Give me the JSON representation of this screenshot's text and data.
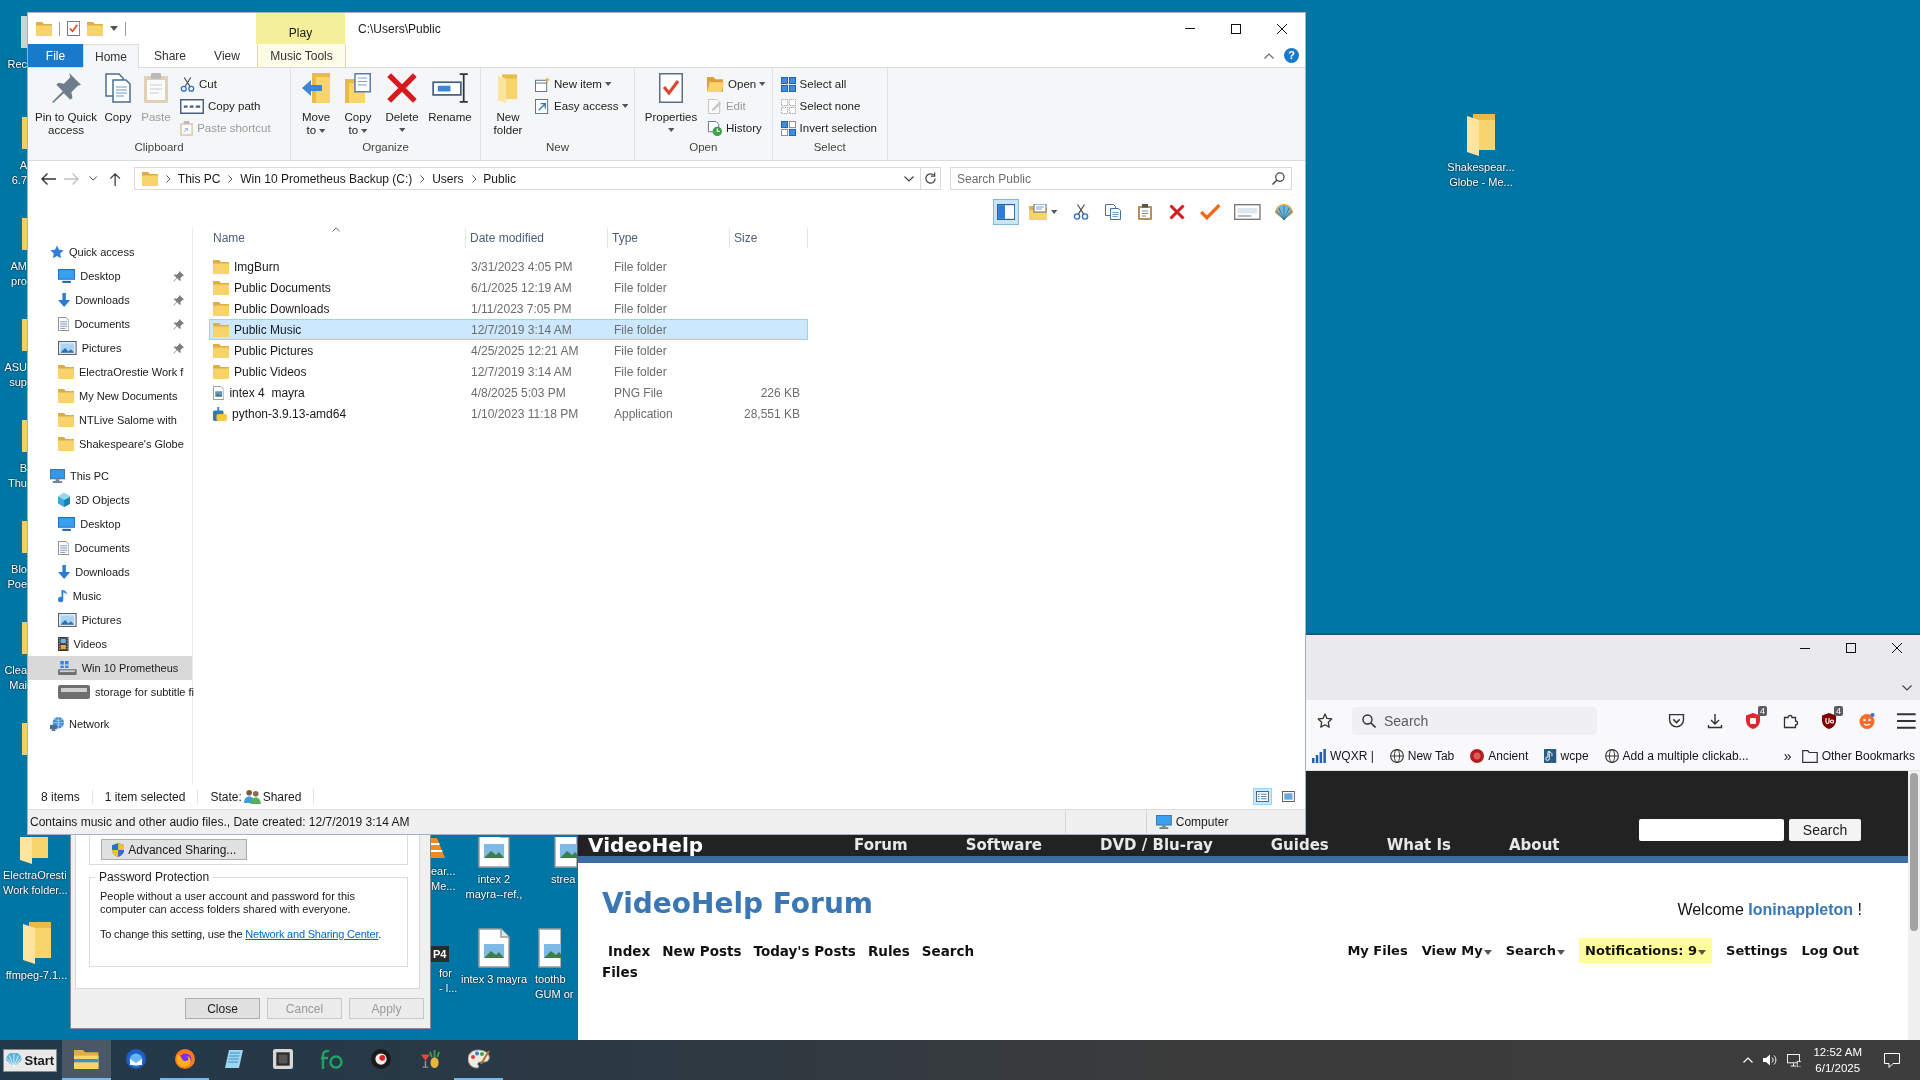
{
  "desktop": {
    "edge_icons": [
      {
        "kind": "recycle",
        "lines": [
          "Rec"
        ]
      },
      {
        "kind": "folder",
        "lines": [
          "A",
          "6.7"
        ]
      },
      {
        "kind": "folder",
        "lines": [
          "AM",
          "pro"
        ]
      },
      {
        "kind": "folder",
        "lines": [
          "ASU",
          "sup"
        ]
      },
      {
        "kind": "folder",
        "lines": [
          "B",
          "Thu"
        ]
      },
      {
        "kind": "folder",
        "lines": [
          "Blo",
          "Poe"
        ]
      },
      {
        "kind": "folder",
        "lines": [
          "Clea",
          "Mai"
        ]
      },
      {
        "kind": "folder"
      }
    ],
    "icons": [
      {
        "kind": "folder",
        "lines": [
          "ElectraOresti",
          "Work folder..."
        ]
      },
      {
        "kind": "folder",
        "lines": [
          "ffmpeg-7.1..."
        ]
      },
      {
        "kind": "cone",
        "lines": [
          "ear...",
          "Me..."
        ]
      },
      {
        "kind": "video",
        "badge": "P4",
        "lines": [
          "for",
          "- l..."
        ]
      },
      {
        "kind": "image",
        "lines": [
          "intex 2",
          "mayra--ref.,"
        ]
      },
      {
        "kind": "image",
        "lines": [
          "intex 3 mayra"
        ]
      },
      {
        "kind": "image",
        "lines": [
          "strea"
        ]
      },
      {
        "kind": "image",
        "lines": [
          "toothb",
          "GUM or"
        ]
      },
      {
        "kind": "folder",
        "lines": [
          "Shakespear...",
          "Globe - Me..."
        ]
      }
    ]
  },
  "explorer": {
    "title": "C:\\Users\\Public",
    "context_header": "Play",
    "help": "?",
    "tabs": [
      {
        "label": "File",
        "kind": "file",
        "selected": false
      },
      {
        "label": "Home",
        "kind": "plain",
        "selected": true
      },
      {
        "label": "Share",
        "kind": "plain",
        "selected": false
      },
      {
        "label": "View",
        "kind": "plain",
        "selected": false
      },
      {
        "label": "Music Tools",
        "kind": "contextual",
        "selected": false
      }
    ],
    "groups": [
      {
        "label": "Clipboard",
        "commands": [
          {
            "label": "Pin to Quick access",
            "kind": "large",
            "menu": false,
            "disabled": false
          },
          {
            "label": "Copy",
            "kind": "large",
            "menu": false,
            "disabled": false
          },
          {
            "label": "Paste",
            "kind": "large",
            "menu": false,
            "disabled": true
          },
          {
            "label": "Cut",
            "kind": "small",
            "menu": false,
            "disabled": false
          },
          {
            "label": "Copy path",
            "kind": "small",
            "menu": false,
            "disabled": false
          },
          {
            "label": "Paste shortcut",
            "kind": "small",
            "menu": false,
            "disabled": true
          }
        ]
      },
      {
        "label": "Organize",
        "commands": [
          {
            "label": "Move to",
            "kind": "large",
            "menu": true,
            "disabled": false
          },
          {
            "label": "Copy to",
            "kind": "large",
            "menu": true,
            "disabled": false
          },
          {
            "label": "Delete",
            "kind": "large",
            "menu": true,
            "disabled": false
          },
          {
            "label": "Rename",
            "kind": "large",
            "menu": false,
            "disabled": false
          }
        ]
      },
      {
        "label": "New",
        "commands": [
          {
            "label": "New folder",
            "kind": "large",
            "menu": false,
            "disabled": false
          },
          {
            "label": "New item",
            "kind": "small",
            "menu": true,
            "disabled": false
          },
          {
            "label": "Easy access",
            "kind": "small",
            "menu": true,
            "disabled": false
          }
        ]
      },
      {
        "label": "Open",
        "commands": [
          {
            "label": "Properties",
            "kind": "large",
            "menu": true,
            "disabled": false
          },
          {
            "label": "Open",
            "kind": "small",
            "menu": true,
            "disabled": false
          },
          {
            "label": "Edit",
            "kind": "small",
            "menu": false,
            "disabled": true
          },
          {
            "label": "History",
            "kind": "small",
            "menu": false,
            "disabled": false
          }
        ]
      },
      {
        "label": "Select",
        "commands": [
          {
            "label": "Select all",
            "kind": "small",
            "menu": false,
            "disabled": false
          },
          {
            "label": "Select none",
            "kind": "small",
            "menu": false,
            "disabled": false
          },
          {
            "label": "Invert selection",
            "kind": "small",
            "menu": false,
            "disabled": false
          }
        ]
      }
    ],
    "nav_buttons": [
      {
        "kind": "back",
        "disabled": false
      },
      {
        "kind": "forward",
        "disabled": true
      },
      {
        "kind": "recent",
        "disabled": false
      },
      {
        "kind": "up",
        "disabled": false
      }
    ],
    "breadcrumbs": [
      "This PC",
      "Win 10 Prometheus Backup (C:)",
      "Users",
      "Public"
    ],
    "search": {
      "placeholder": "Search Public"
    },
    "toolbar_buttons": [
      {
        "kind": "pane",
        "selected": true,
        "menu": false
      },
      {
        "kind": "layout",
        "selected": false,
        "menu": true
      },
      {
        "kind": "cut",
        "selected": false,
        "menu": false
      },
      {
        "kind": "copy",
        "selected": false,
        "menu": false
      },
      {
        "kind": "paste",
        "selected": false,
        "menu": false
      },
      {
        "kind": "delete",
        "selected": false,
        "menu": false
      },
      {
        "kind": "confirm",
        "selected": false,
        "menu": false
      },
      {
        "kind": "card",
        "selected": false,
        "menu": false
      },
      {
        "kind": "shell",
        "selected": false,
        "menu": false
      }
    ],
    "columns": [
      {
        "label": "Name",
        "sorted": true
      },
      {
        "label": "Date modified",
        "sorted": false
      },
      {
        "label": "Type",
        "sorted": false
      },
      {
        "label": "Size",
        "sorted": false
      }
    ],
    "files": [
      {
        "name": "ImgBurn",
        "kind": "folder",
        "date": "3/31/2023 4:05 PM",
        "type": "File folder",
        "selected": false
      },
      {
        "name": "Public Documents",
        "kind": "folder",
        "date": "6/1/2025 12:19 AM",
        "type": "File folder",
        "selected": false
      },
      {
        "name": "Public Downloads",
        "kind": "folder",
        "date": "1/11/2023 7:05 PM",
        "type": "File folder",
        "selected": false
      },
      {
        "name": "Public Music",
        "kind": "folder",
        "date": "12/7/2019 3:14 AM",
        "type": "File folder",
        "selected": true
      },
      {
        "name": "Public Pictures",
        "kind": "folder",
        "date": "4/25/2025 12:21 AM",
        "type": "File folder",
        "selected": false
      },
      {
        "name": "Public Videos",
        "kind": "folder",
        "date": "12/7/2019 3:14 AM",
        "type": "File folder",
        "selected": false
      },
      {
        "name": "intex 4  mayra",
        "kind": "image",
        "date": "4/8/2025 5:03 PM",
        "type": "PNG File",
        "size": "226 KB",
        "selected": false
      },
      {
        "name": "python-3.9.13-amd64",
        "kind": "installer",
        "date": "1/10/2023 11:18 PM",
        "type": "Application",
        "size": "28,551 KB",
        "selected": false
      }
    ],
    "nav_tree": [
      {
        "label": "Quick access",
        "kind": "star",
        "selected": false,
        "pinned": false,
        "children": [
          {
            "label": "Desktop",
            "kind": "desktop",
            "selected": false,
            "pinned": true
          },
          {
            "label": "Downloads",
            "kind": "downloads",
            "selected": false,
            "pinned": true
          },
          {
            "label": "Documents",
            "kind": "documents",
            "selected": false,
            "pinned": true
          },
          {
            "label": "Pictures",
            "kind": "pictures",
            "selected": false,
            "pinned": true
          },
          {
            "label": "ElectraOrestie Work f",
            "kind": "folder",
            "selected": false,
            "pinned": false
          },
          {
            "label": "My New Documents",
            "kind": "folder",
            "selected": false,
            "pinned": false
          },
          {
            "label": "NTLive Salome with",
            "kind": "folder",
            "selected": false,
            "pinned": false
          },
          {
            "label": "Shakespeare's Globe",
            "kind": "folder",
            "selected": false,
            "pinned": false
          }
        ]
      },
      {
        "label": "This PC",
        "kind": "pc",
        "selected": false,
        "pinned": false,
        "children": [
          {
            "label": "3D Objects",
            "kind": "objects3d",
            "selected": false,
            "pinned": false
          },
          {
            "label": "Desktop",
            "kind": "desktop",
            "selected": false,
            "pinned": false
          },
          {
            "label": "Documents",
            "kind": "documents",
            "selected": false,
            "pinned": false
          },
          {
            "label": "Downloads",
            "kind": "downloads",
            "selected": false,
            "pinned": false
          },
          {
            "label": "Music",
            "kind": "music",
            "selected": false,
            "pinned": false
          },
          {
            "label": "Pictures",
            "kind": "pictures",
            "selected": false,
            "pinned": false
          },
          {
            "label": "Videos",
            "kind": "videos",
            "selected": false,
            "pinned": false
          },
          {
            "label": "Win 10 Prometheus",
            "kind": "system-drive",
            "selected": true,
            "pinned": false
          },
          {
            "label": "storage for subtitle fi",
            "kind": "drive",
            "selected": false,
            "pinned": false
          }
        ]
      },
      {
        "label": "Network",
        "kind": "network",
        "selected": false,
        "pinned": false
      }
    ],
    "status": {
      "count": "8 items",
      "selection": "1 item selected",
      "state_label": "State:",
      "state": "Shared",
      "views": [
        {
          "kind": "details",
          "selected": true
        },
        {
          "kind": "large-icons",
          "selected": false
        }
      ]
    },
    "details": {
      "text": "Contains music and other audio files., Date created: 12/7/2019 3:14 AM",
      "location": "Computer"
    }
  },
  "sharing_dialog": {
    "advanced_button": "Advanced Sharing...",
    "group_title": "Password Protection",
    "paragraph": "People without a user account and password for this computer can access folders shared with everyone.",
    "hint": "To change this setting, use the",
    "link": "Network and Sharing Center",
    "hint_end": ".",
    "buttons": [
      {
        "label": "Close",
        "disabled": false
      },
      {
        "label": "Cancel",
        "disabled": true
      },
      {
        "label": "Apply",
        "disabled": true
      }
    ]
  },
  "browser": {
    "search": {
      "placeholder": "Search"
    },
    "toolbar": [
      {
        "kind": "pocket"
      },
      {
        "kind": "download"
      },
      {
        "kind": "shield",
        "badge": "4"
      },
      {
        "kind": "puzzle"
      },
      {
        "kind": "ublock",
        "badge": "4"
      },
      {
        "kind": "face"
      },
      {
        "kind": "menu"
      }
    ],
    "bookmarks": [
      {
        "label": "WQXR |",
        "kind": "bars"
      },
      {
        "label": "New Tab",
        "kind": "globe"
      },
      {
        "label": "Ancient",
        "kind": "red-logo"
      },
      {
        "label": "wcpe",
        "kind": "music"
      },
      {
        "label": "Add a multiple clickab...",
        "kind": "globe"
      }
    ],
    "overflow": "»",
    "other_bookmarks": "Other Bookmarks",
    "page": {
      "logo": "VideoHelp",
      "nav": [
        "Forum",
        "Software",
        "DVD / Blu-ray",
        "Guides",
        "What Is",
        "About"
      ],
      "search_button": "Search",
      "title": "VideoHelp Forum",
      "welcome": "Welcome",
      "username": "Ioninappleton",
      "welcome_end": "!",
      "links": [
        "Index",
        "New Posts",
        "Today's Posts",
        "Rules",
        "Search",
        "Files"
      ],
      "user_links": [
        {
          "label": "My Files",
          "menu": false,
          "highlighted": false
        },
        {
          "label": "View My",
          "menu": true,
          "highlighted": false
        },
        {
          "label": "Search",
          "menu": true,
          "highlighted": false
        },
        {
          "label": "Notifications: 9",
          "menu": true,
          "highlighted": true
        },
        {
          "label": "Settings",
          "menu": false,
          "highlighted": false
        },
        {
          "label": "Log Out",
          "menu": false,
          "highlighted": false
        }
      ]
    }
  },
  "taskbar": {
    "start": "Start",
    "apps": [
      {
        "kind": "explorer",
        "running": true,
        "active": true
      },
      {
        "kind": "thunderbird",
        "running": false,
        "active": false
      },
      {
        "kind": "firefox",
        "running": true,
        "active": false
      },
      {
        "kind": "notepad",
        "running": false,
        "active": false
      },
      {
        "kind": "chip",
        "running": false,
        "active": false
      },
      {
        "kind": "fo",
        "running": false,
        "active": false
      },
      {
        "kind": "orb",
        "running": false,
        "active": false
      },
      {
        "kind": "cocktail",
        "running": false,
        "active": false
      },
      {
        "kind": "paint",
        "running": true,
        "active": false
      }
    ],
    "time": "12:52 AM",
    "date": "6/1/2025"
  }
}
